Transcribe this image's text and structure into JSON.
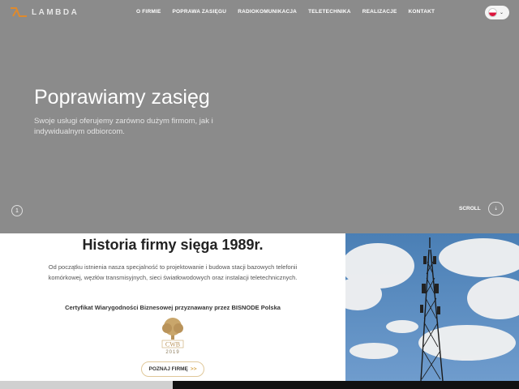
{
  "header": {
    "logo_text": "LAMBDA",
    "nav": [
      "O FIRMIE",
      "POPRAWA ZASIĘGU",
      "RADIOKOMUNIKACJA",
      "TELETECHNIKA",
      "REALIZACJE",
      "KONTAKT"
    ],
    "language": {
      "icon": "poland-flag-icon",
      "chevron": "⌄"
    }
  },
  "hero": {
    "title": "Poprawiamy zasięg",
    "subtitle": "Swoje usługi oferujemy zarówno dużym firmom, jak i indywidualnym odbiorcom.",
    "slide_indicator": "1",
    "scroll_label": "SCROLL",
    "scroll_icon": "⇣"
  },
  "history": {
    "title": "Historia firmy sięga 1989r.",
    "text": "Od początku istnienia nasza specjalność to projektowanie i budowa stacji bazowych telefonii komórkowej, węzłów transmisyjnych, sieci światłowodowych oraz instalacji teletechnicznych.",
    "certificate": "Certyfikat Wiarygodności Biznesowej przyznawany przez BISNODE Polska",
    "badge_text": "CWB",
    "badge_year": "2019",
    "button_label": "POZNAJ FIRMĘ",
    "button_arrow": ">>"
  },
  "colors": {
    "hero_bg": "#8b8b8b",
    "accent": "#d5a54a",
    "logo_mark": "#e08a2c"
  }
}
